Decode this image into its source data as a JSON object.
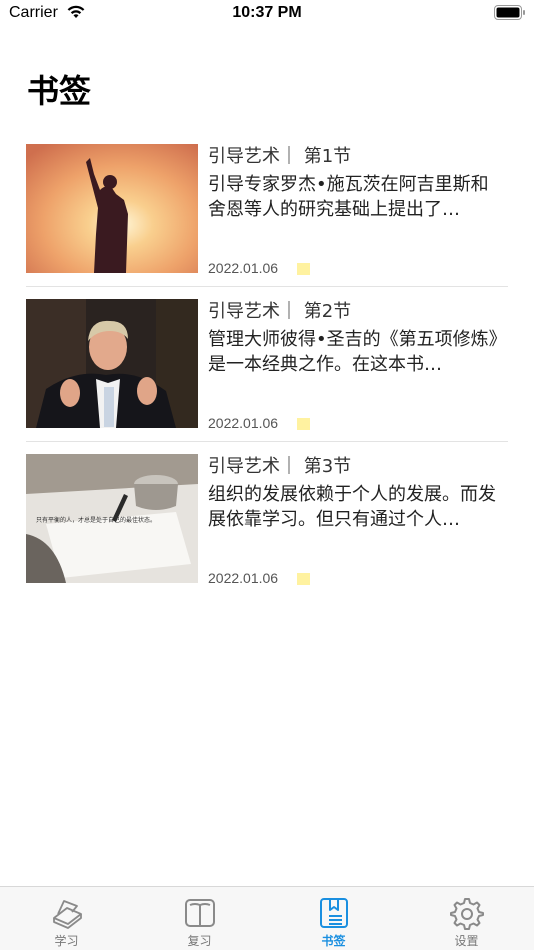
{
  "status_bar": {
    "carrier": "Carrier",
    "time": "10:37 PM"
  },
  "page": {
    "title": "书签"
  },
  "bookmarks": [
    {
      "title": "引导艺术｜ 第1节",
      "description": "引导专家罗杰•施瓦茨在阿吉里斯和舍恩等人的研究基础上提出了…",
      "date": "2022.01.06",
      "image": "sunset-silhouette"
    },
    {
      "title": "引导艺术｜ 第2节",
      "description": "管理大师彼得•圣吉的《第五项修炼》是一本经典之作。在这本书…",
      "date": "2022.01.06",
      "image": "speaker-portrait"
    },
    {
      "title": "引导艺术｜ 第3节",
      "description": "组织的发展依赖于个人的发展。而发展依靠学习。但只有通过个人…",
      "date": "2022.01.06",
      "image": "writing-desk",
      "image_caption": "只有平衡的人，才总是处于自己的最佳状态。"
    }
  ],
  "tabs": [
    {
      "label": "学习",
      "icon": "book-stack-icon",
      "active": false
    },
    {
      "label": "复习",
      "icon": "open-book-icon",
      "active": false
    },
    {
      "label": "书签",
      "icon": "bookmark-list-icon",
      "active": true
    },
    {
      "label": "设置",
      "icon": "gear-icon",
      "active": false
    }
  ],
  "colors": {
    "accent": "#1a8fe0",
    "highlight_mark": "#fff2a0",
    "inactive_tab": "#777777"
  }
}
